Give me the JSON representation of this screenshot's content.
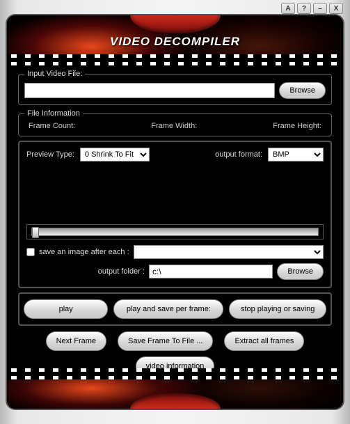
{
  "titlebar": {
    "a": "A",
    "q": "?",
    "min": "–",
    "close": "X"
  },
  "app_title": "VIDEO DECOMPILER",
  "groups": {
    "input": {
      "legend": "Input Video File:",
      "path": "",
      "browse": "Browse"
    },
    "fileinfo": {
      "legend": "File Information",
      "frame_count": "Frame Count:",
      "frame_width": "Frame Width:",
      "frame_height": "Frame Height:"
    }
  },
  "preview": {
    "type_label": "Preview Type:",
    "type_value": "0  Shrink To Fit",
    "output_format_label": "output format:",
    "output_format_value": "BMP"
  },
  "save": {
    "checkbox_label": "save an image after each :",
    "interval_value": "",
    "output_folder_label": "output folder :",
    "output_folder_value": "c:\\",
    "browse": "Browse"
  },
  "buttons": {
    "play": "play",
    "play_save": "play and save per frame:",
    "stop": "stop playing or saving",
    "next_frame": "Next Frame",
    "save_frame": "Save Frame To File ...",
    "extract_all": "Extract all frames",
    "video_info": "video information"
  }
}
